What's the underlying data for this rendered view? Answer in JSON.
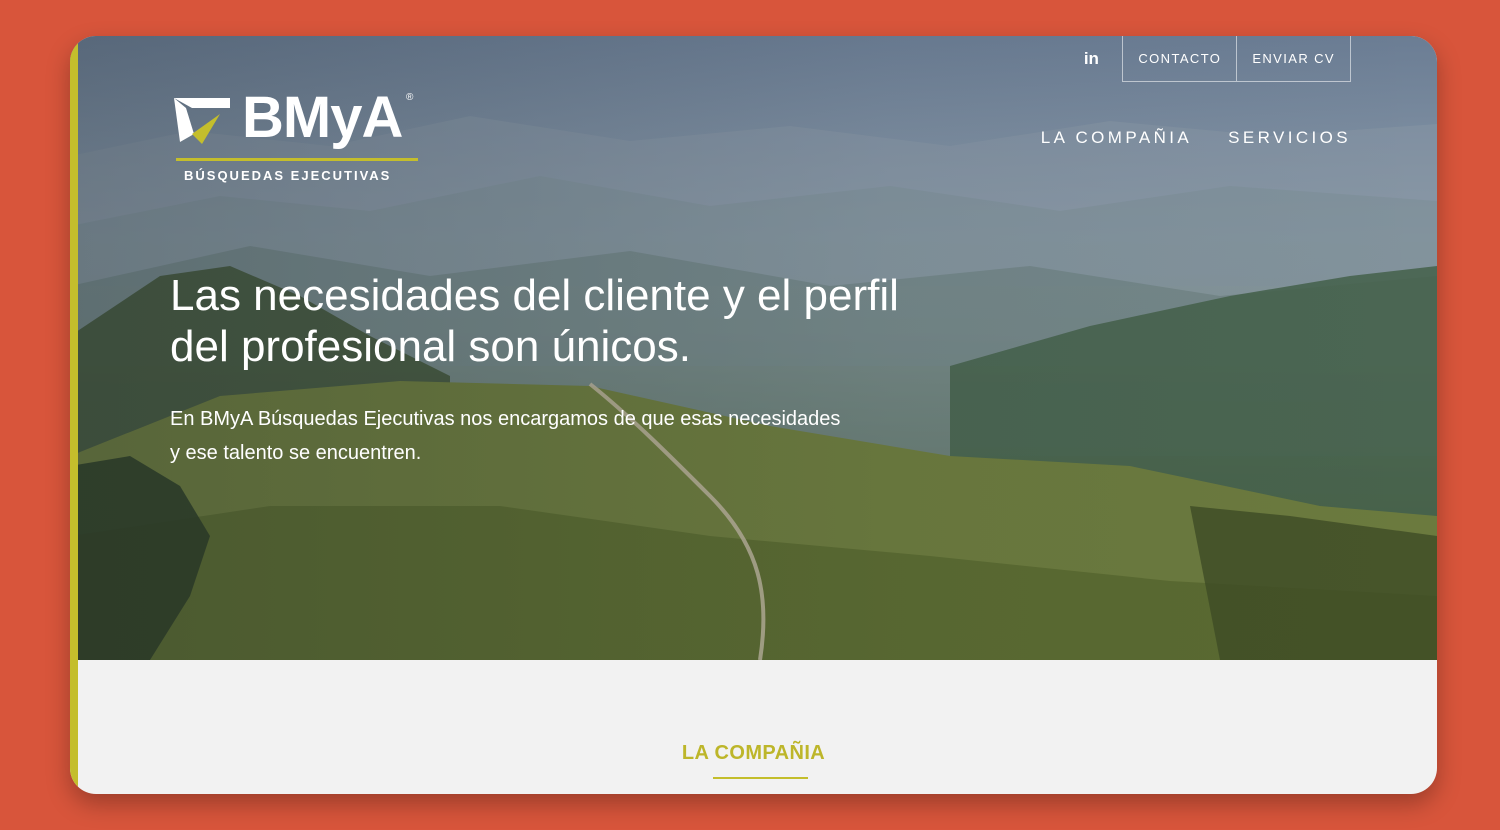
{
  "header": {
    "utility_nav": {
      "linkedin_label": "in",
      "contact_label": "CONTACTO",
      "send_cv_label": "ENVIAR CV"
    },
    "logo": {
      "brand": "BMyA",
      "registered": "®",
      "tagline": "BÚSQUEDAS EJECUTIVAS"
    },
    "main_nav": {
      "items": [
        {
          "label": "LA COMPAÑIA"
        },
        {
          "label": "SERVICIOS"
        }
      ]
    }
  },
  "hero": {
    "headline_line1": "Las necesidades del cliente y el perfil",
    "headline_line2": "del profesional son únicos.",
    "subhead_line1": "En BMyA Búsquedas Ejecutivas nos encargamos de que esas necesidades",
    "subhead_line2": "y ese talento se encuentren."
  },
  "section": {
    "title": "LA COMPAÑIA"
  },
  "colors": {
    "page_background": "#d8553b",
    "accent": "#c4be2c",
    "section_title": "#bdb62a",
    "content_background": "#f2f2f2"
  }
}
